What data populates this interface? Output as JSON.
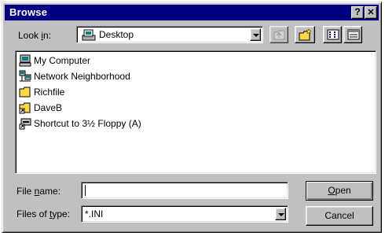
{
  "window": {
    "title": "Browse",
    "help_label": "?",
    "close_label": "✕"
  },
  "look_in": {
    "label_pre": "Look ",
    "label_accel": "i",
    "label_post": "n:",
    "value": "Desktop",
    "icon": "desktop-icon"
  },
  "toolbar": {
    "up_icon": "up-one-level-icon",
    "new_folder_icon": "new-folder-icon",
    "list_icon": "list-view-icon",
    "details_icon": "details-view-icon"
  },
  "files": [
    {
      "label": "My Computer",
      "icon": "computer-icon"
    },
    {
      "label": "Network Neighborhood",
      "icon": "network-icon"
    },
    {
      "label": "Richfile",
      "icon": "folder-icon"
    },
    {
      "label": "DaveB",
      "icon": "shortcut-folder-icon"
    },
    {
      "label": "Shortcut to 3½ Floppy (A)",
      "icon": "floppy-shortcut-icon"
    }
  ],
  "file_name": {
    "label_pre": "File ",
    "label_accel": "n",
    "label_post": "ame:",
    "value": ""
  },
  "file_type": {
    "label_pre": "Files of ",
    "label_accel": "t",
    "label_post": "ype:",
    "value": "*.INI"
  },
  "buttons": {
    "open_accel": "O",
    "open_rest": "pen",
    "cancel": "Cancel"
  },
  "colors": {
    "titlebar": "#000080",
    "face": "#c0c0c0",
    "folder": "#ffd84a"
  }
}
